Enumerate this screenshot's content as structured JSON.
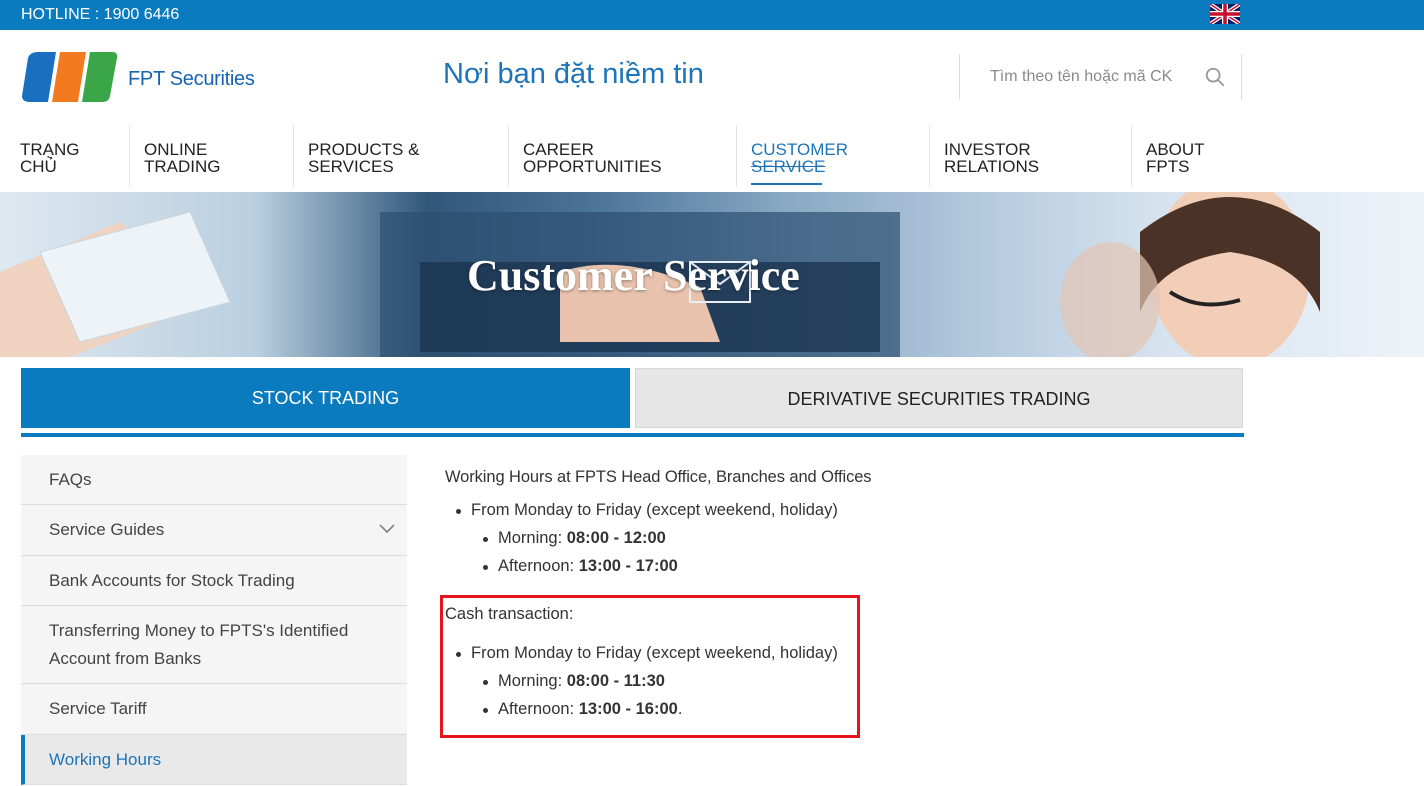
{
  "topbar": {
    "hotline": "HOTLINE : 1900 6446",
    "language_flag_icon": "uk-flag-icon"
  },
  "header": {
    "logo_text": "FPT Securities",
    "slogan": "Nơi bạn đặt niềm tin",
    "search_placeholder": "Tìm theo tên hoặc mã CK",
    "search_icon": "search-icon"
  },
  "nav": {
    "items": [
      {
        "line1": "TRẠNG",
        "line2": "CHỦ"
      },
      {
        "line1": "ONLINE",
        "line2": "TRADING"
      },
      {
        "line1": "PRODUCTS &",
        "line2": "SERVICES"
      },
      {
        "line1": "CAREER",
        "line2": "OPPORTUNITIES"
      },
      {
        "line1": "CUSTOMER",
        "line2": "SERVICE",
        "active": true
      },
      {
        "line1": "INVESTOR",
        "line2": "RELATIONS"
      },
      {
        "line1": "ABOUT",
        "line2": "FPTS"
      }
    ]
  },
  "banner": {
    "title": "Customer Service"
  },
  "tabs": {
    "stock": "STOCK TRADING",
    "derivative": "DERIVATIVE SECURITIES TRADING"
  },
  "sidebar": {
    "items": [
      {
        "label": "FAQs"
      },
      {
        "label": "Service Guides",
        "has_chevron": true
      },
      {
        "label": "Bank Accounts for Stock Trading"
      },
      {
        "label": "Transferring Money to FPTS's Identified Account from Banks"
      },
      {
        "label": "Service Tariff"
      },
      {
        "label": "Working Hours",
        "active": true
      }
    ]
  },
  "content": {
    "heading": "Working Hours at FPTS Head Office, Branches and Offices",
    "period": "From Monday to Friday (except weekend, holiday)",
    "morning_label": "Morning:",
    "morning_time": "08:00 - 12:00",
    "afternoon_label": "Afternoon:",
    "afternoon_time": "13:00 - 17:00",
    "cash": {
      "heading": "Cash transaction:",
      "period": "From Monday to Friday (except weekend, holiday)",
      "morning_label": "Morning:",
      "morning_time": "08:00 - 11:30",
      "afternoon_label": "Afternoon:",
      "afternoon_time": "13:00 - 16:00",
      "afternoon_suffix": "."
    }
  },
  "colors": {
    "brand_blue": "#0a7bbf",
    "link_blue": "#1d74b8",
    "highlight_red": "#e8141b"
  }
}
